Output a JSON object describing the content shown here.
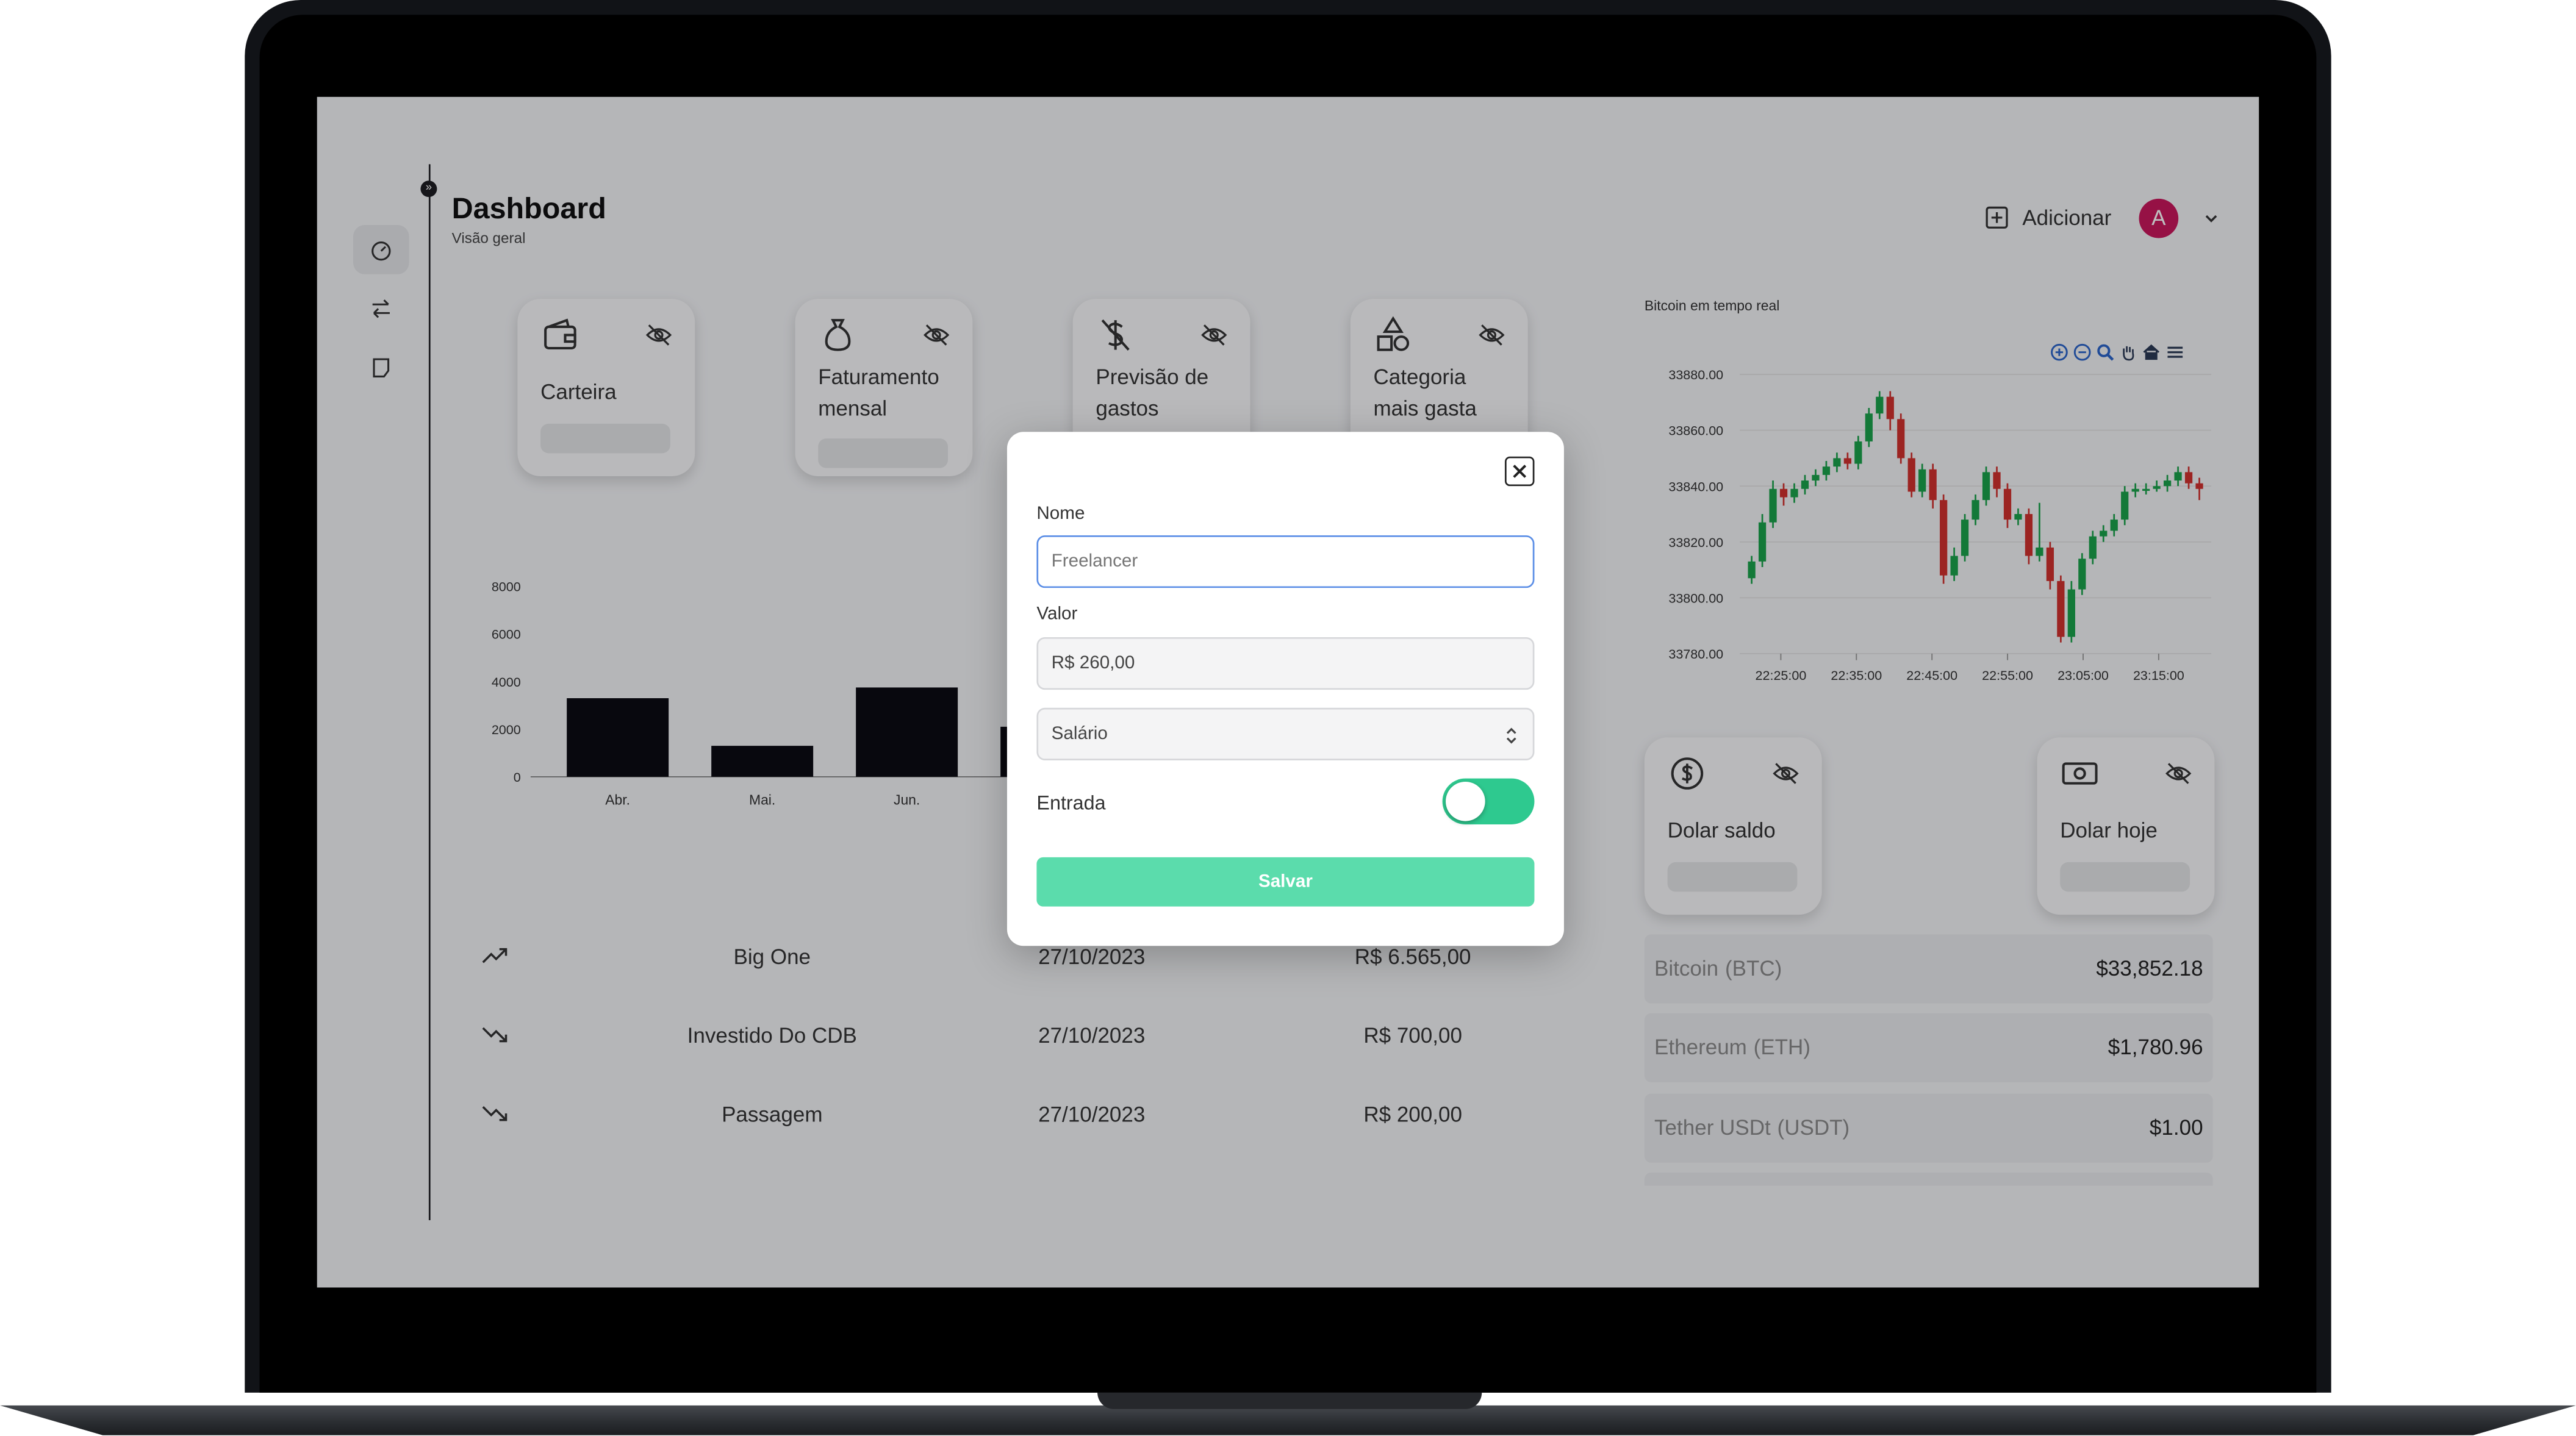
{
  "header": {
    "title": "Dashboard",
    "subtitle": "Visão geral",
    "add_label": "Adicionar",
    "avatar_letter": "A"
  },
  "sidebar": {
    "items": [
      {
        "icon": "gauge-icon"
      },
      {
        "icon": "transfer-icon"
      },
      {
        "icon": "note-icon"
      }
    ]
  },
  "cards": [
    {
      "label": "Carteira",
      "icon": "wallet-icon"
    },
    {
      "label": "Faturamento mensal",
      "icon": "money-bag-icon"
    },
    {
      "label": "Previsão de gastos",
      "icon": "dollar-slash-icon"
    },
    {
      "label": "Categoria mais gasta",
      "icon": "shapes-icon"
    },
    {
      "label": "Dolar saldo",
      "icon": "dollar-circle-icon"
    },
    {
      "label": "Dolar hoje",
      "icon": "banknote-icon"
    }
  ],
  "chart_data": [
    {
      "type": "bar",
      "categories": [
        "Abr.",
        "Mai.",
        "Jun."
      ],
      "values": [
        3300,
        1300,
        3750
      ],
      "ylim": [
        0,
        8000
      ],
      "yticks": [
        "8000",
        "6000",
        "4000",
        "2000",
        "0"
      ],
      "color": "#0b0b12"
    },
    {
      "type": "candlestick",
      "title": "Bitcoin em tempo real",
      "yticks": [
        "33880.00",
        "33860.00",
        "33840.00",
        "33820.00",
        "33800.00",
        "33780.00"
      ],
      "xticks": [
        "22:25:00",
        "22:35:00",
        "22:45:00",
        "22:55:00",
        "23:05:00",
        "23:15:00"
      ],
      "ylim": [
        33780,
        33880
      ],
      "up_color": "#1aa24a",
      "down_color": "#d0312d",
      "candles": [
        [
          33807,
          33813,
          33805,
          33815
        ],
        [
          33813,
          33827,
          33811,
          33830
        ],
        [
          33827,
          33839,
          33825,
          33842
        ],
        [
          33839,
          33836,
          33833,
          33841
        ],
        [
          33836,
          33839,
          33834,
          33841
        ],
        [
          33839,
          33842,
          33837,
          33844
        ],
        [
          33842,
          33844,
          33840,
          33846
        ],
        [
          33844,
          33847,
          33842,
          33849
        ],
        [
          33847,
          33850,
          33845,
          33852
        ],
        [
          33850,
          33848,
          33846,
          33852
        ],
        [
          33848,
          33856,
          33846,
          33858
        ],
        [
          33856,
          33866,
          33854,
          33868
        ],
        [
          33866,
          33872,
          33864,
          33874
        ],
        [
          33872,
          33864,
          33860,
          33874
        ],
        [
          33864,
          33850,
          33848,
          33866
        ],
        [
          33850,
          33838,
          33836,
          33852
        ],
        [
          33838,
          33846,
          33836,
          33848
        ],
        [
          33846,
          33835,
          33832,
          33848
        ],
        [
          33835,
          33808,
          33805,
          33837
        ],
        [
          33808,
          33815,
          33806,
          33818
        ],
        [
          33815,
          33828,
          33813,
          33830
        ],
        [
          33828,
          33835,
          33826,
          33837
        ],
        [
          33835,
          33845,
          33833,
          33847
        ],
        [
          33845,
          33839,
          33836,
          33847
        ],
        [
          33839,
          33828,
          33825,
          33841
        ],
        [
          33828,
          33830,
          33826,
          33832
        ],
        [
          33830,
          33815,
          33812,
          33832
        ],
        [
          33815,
          33818,
          33813,
          33834
        ],
        [
          33818,
          33806,
          33803,
          33820
        ],
        [
          33806,
          33786,
          33784,
          33808
        ],
        [
          33786,
          33803,
          33784,
          33806
        ],
        [
          33803,
          33814,
          33801,
          33816
        ],
        [
          33814,
          33822,
          33812,
          33824
        ],
        [
          33822,
          33824,
          33820,
          33826
        ],
        [
          33824,
          33828,
          33822,
          33830
        ],
        [
          33828,
          33838,
          33826,
          33840
        ],
        [
          33838,
          33839,
          33836,
          33841
        ],
        [
          33839,
          33839,
          33837,
          33841
        ],
        [
          33839,
          33840,
          33838,
          33842
        ],
        [
          33840,
          33842,
          33838,
          33844
        ],
        [
          33842,
          33845,
          33840,
          33847
        ],
        [
          33845,
          33841,
          33839,
          33847
        ],
        [
          33841,
          33839,
          33835,
          33843
        ]
      ]
    }
  ],
  "transactions": [
    {
      "direction": "up",
      "name": "Big One",
      "date": "27/10/2023",
      "value": "R$ 6.565,00"
    },
    {
      "direction": "down",
      "name": "Investido Do CDB",
      "date": "27/10/2023",
      "value": "R$ 700,00"
    },
    {
      "direction": "down",
      "name": "Passagem",
      "date": "27/10/2023",
      "value": "R$ 200,00"
    }
  ],
  "crypto": [
    {
      "name": "Bitcoin",
      "symbol": "(BTC)",
      "price": "$33,852.18"
    },
    {
      "name": "Ethereum",
      "symbol": "(ETH)",
      "price": "$1,780.96"
    },
    {
      "name": "Tether USDt",
      "symbol": "(USDT)",
      "price": "$1.00"
    }
  ],
  "modal": {
    "nome_label": "Nome",
    "nome_placeholder": "Freelancer",
    "valor_label": "Valor",
    "valor_value": "R$ 260,00",
    "categoria_value": "Salário",
    "entrada_label": "Entrada",
    "entrada_on": true,
    "save_label": "Salvar"
  }
}
